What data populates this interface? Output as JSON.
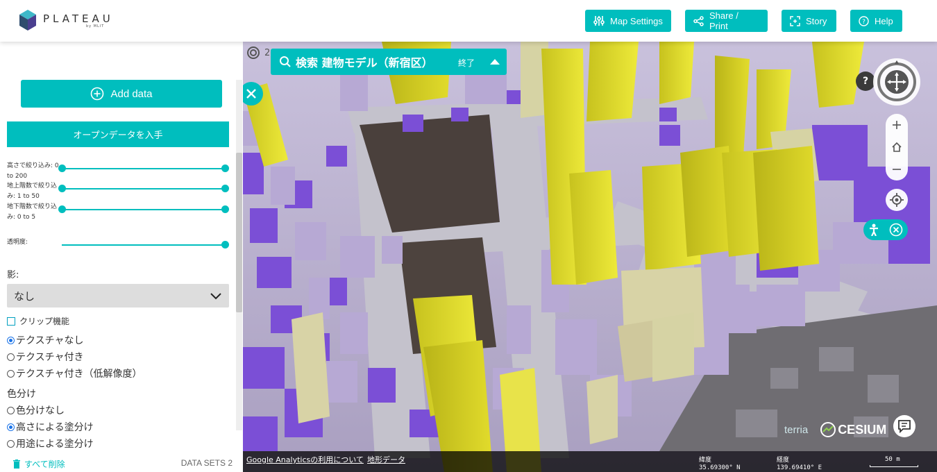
{
  "header": {
    "logo_word": "PLATEAU",
    "logo_sub": "by MLIT",
    "buttons": {
      "map_settings": "Map Settings",
      "share_print": "Share / Print",
      "story": "Story",
      "help": "Help"
    }
  },
  "sidebar": {
    "add_data": "Add data",
    "open_data": "オープンデータを入手",
    "filters": [
      {
        "label": "高さで絞り込み: 0 to 200"
      },
      {
        "label": "地上階数で絞り込み: 1 to 50"
      },
      {
        "label": "地下階数で絞り込み: 0 to 5"
      }
    ],
    "opacity_label": "透明度:",
    "shadow_label": "影:",
    "shadow_value": "なし",
    "clip_label": "クリップ機能",
    "texture_options": [
      "テクスチャなし",
      "テクスチャ付き",
      "テクスチャ付き（低解像度）"
    ],
    "color_label": "色分け",
    "color_options": [
      "色分けなし",
      "高さによる塗分け",
      "用途による塗分け"
    ],
    "delete_all": "すべて削除",
    "datasets": "DATA SETS 2"
  },
  "map": {
    "search_title": "検索 建物モデル（新宿区）",
    "search_end": "終了",
    "behind_text": "2",
    "help_glyph": "?",
    "credits": {
      "terria": "terria",
      "cesium": "CESIUM"
    },
    "status": {
      "ga_link": "Google Analyticsの利用について",
      "terrain_link": "地形データ",
      "lat_label": "緯度",
      "lat_value": "35.69300° N",
      "lon_label": "経度",
      "lon_value": "139.69410° E",
      "scale": "50 m"
    }
  },
  "colors": {
    "accent": "#00bebe",
    "building_purple": "#7b4fd6",
    "building_lavender": "#b7a9d4",
    "building_yellow": "#d9d624"
  }
}
